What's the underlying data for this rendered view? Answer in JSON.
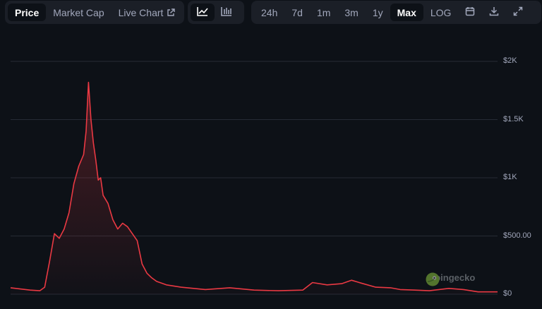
{
  "tabs": {
    "price": "Price",
    "market_cap": "Market Cap",
    "live_chart": "Live Chart"
  },
  "chart_icons": [
    "line-chart-icon",
    "candlestick-chart-icon"
  ],
  "ranges": {
    "r24h": "24h",
    "r7d": "7d",
    "r1m": "1m",
    "r3m": "3m",
    "r1y": "1y",
    "rmax": "Max",
    "log": "LOG"
  },
  "actions": [
    "calendar-icon",
    "download-icon",
    "expand-icon"
  ],
  "watermark": "coingecko",
  "colors": {
    "line": "#ea3943",
    "background": "#0d1117",
    "toolbar": "#1b1f27",
    "grid": "#262b35"
  },
  "chart_data": {
    "type": "area",
    "series": [
      {
        "x": [
          0,
          0.02,
          0.04,
          0.06,
          0.07,
          0.08,
          0.09,
          0.1,
          0.11,
          0.12,
          0.13,
          0.14,
          0.15,
          0.155,
          0.16,
          0.165,
          0.17,
          0.175,
          0.18,
          0.185,
          0.19,
          0.2,
          0.21,
          0.22,
          0.23,
          0.24,
          0.25,
          0.26,
          0.27,
          0.28,
          0.29,
          0.3,
          0.32,
          0.35,
          0.4,
          0.45,
          0.5,
          0.55,
          0.6,
          0.62,
          0.65,
          0.68,
          0.7,
          0.72,
          0.75,
          0.78,
          0.8,
          0.83,
          0.86,
          0.9,
          0.93,
          0.96,
          1.0
        ],
        "values": [
          55,
          45,
          35,
          30,
          60,
          280,
          520,
          480,
          560,
          700,
          950,
          1100,
          1200,
          1400,
          1820,
          1500,
          1300,
          1150,
          980,
          1000,
          850,
          780,
          640,
          560,
          610,
          580,
          520,
          460,
          260,
          180,
          140,
          110,
          80,
          60,
          40,
          55,
          35,
          30,
          35,
          100,
          80,
          90,
          120,
          95,
          60,
          55,
          40,
          35,
          30,
          50,
          40,
          20,
          20
        ]
      }
    ],
    "ytick_labels": [
      "$2K",
      "$1.5K",
      "$1K",
      "$500.00",
      "$0"
    ],
    "ylim": [
      0,
      2000
    ]
  }
}
